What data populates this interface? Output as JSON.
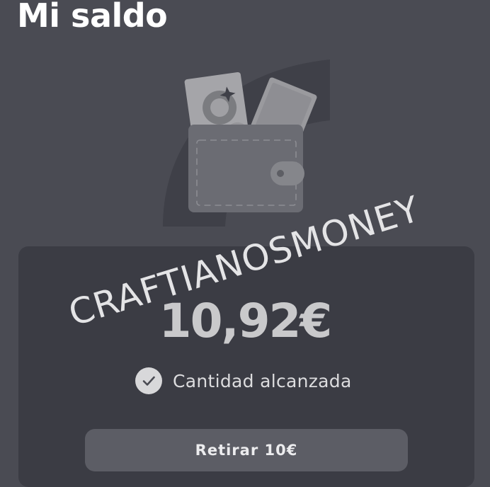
{
  "header": {
    "title": "Mi saldo"
  },
  "illustration": {
    "icon": "wallet-with-banknotes-icon"
  },
  "balance": {
    "amount": "10,92€",
    "status_icon": "check-circle-icon",
    "status_text": "Cantidad alcanzada"
  },
  "actions": {
    "withdraw_label": "Retirar 10€"
  },
  "watermark": {
    "text": "CRAFTIANOSMONEY"
  },
  "colors": {
    "background": "#4a4b53",
    "card": "#3b3c44",
    "button": "#5c5d65",
    "text_primary": "#ffffff"
  }
}
